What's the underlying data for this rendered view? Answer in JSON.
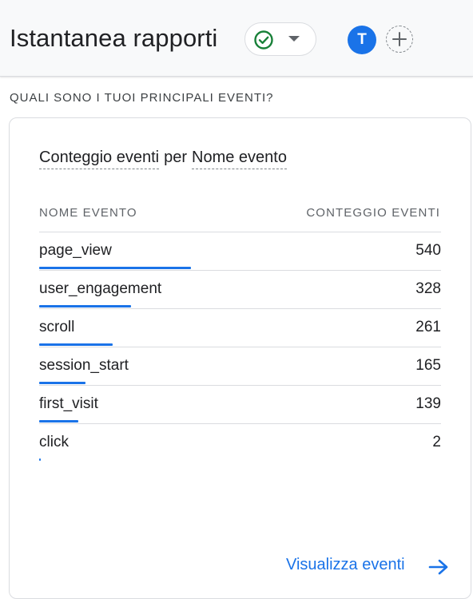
{
  "header": {
    "title": "Istantanea rapporti",
    "avatar_initial": "T"
  },
  "section": {
    "heading": "QUALI SONO I TUOI PRINCIPALI EVENTI?"
  },
  "card": {
    "metric": "Conteggio eventi",
    "connector": "per",
    "dimension": "Nome evento",
    "columns": {
      "name": "NOME EVENTO",
      "count": "CONTEGGIO EVENTI"
    },
    "rows": [
      {
        "name": "page_view",
        "count": "540",
        "value": 540
      },
      {
        "name": "user_engagement",
        "count": "328",
        "value": 328
      },
      {
        "name": "scroll",
        "count": "261",
        "value": 261
      },
      {
        "name": "session_start",
        "count": "165",
        "value": 165
      },
      {
        "name": "first_visit",
        "count": "139",
        "value": 139
      },
      {
        "name": "click",
        "count": "2",
        "value": 2
      }
    ],
    "link_label": "Visualizza eventi"
  },
  "colors": {
    "accent": "#1a73e8",
    "status_ok": "#188038"
  },
  "icons": {
    "status": "check-circle-icon",
    "dropdown": "caret-down-icon",
    "add": "add-user-icon",
    "link": "arrow-right-icon"
  }
}
